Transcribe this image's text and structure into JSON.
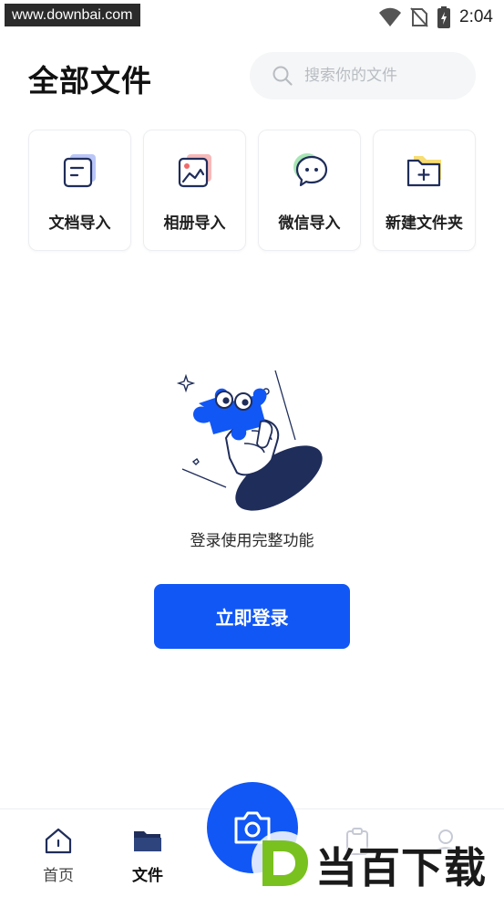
{
  "watermark_top": "www.downbai.com",
  "status": {
    "time": "2:04"
  },
  "header": {
    "title": "全部文件"
  },
  "search": {
    "placeholder": "搜索你的文件"
  },
  "quick_actions": [
    {
      "label": "文档导入",
      "icon": "document-import-icon"
    },
    {
      "label": "相册导入",
      "icon": "album-import-icon"
    },
    {
      "label": "微信导入",
      "icon": "wechat-import-icon"
    },
    {
      "label": "新建文件夹",
      "icon": "new-folder-icon"
    }
  ],
  "empty_state": {
    "illustration": "puzzle-hand-illustration",
    "hint": "登录使用完整功能",
    "button_label": "立即登录"
  },
  "bottom_nav": [
    {
      "label": "首页",
      "icon": "home-icon",
      "active": false
    },
    {
      "label": "文件",
      "icon": "folder-icon",
      "active": true
    }
  ],
  "camera_button": {
    "icon": "camera-icon"
  },
  "brand_watermark": {
    "text": "当百下载"
  },
  "colors": {
    "accent": "#1157f6",
    "navy": "#1f2d5a",
    "search_bg": "#f5f6f7"
  }
}
